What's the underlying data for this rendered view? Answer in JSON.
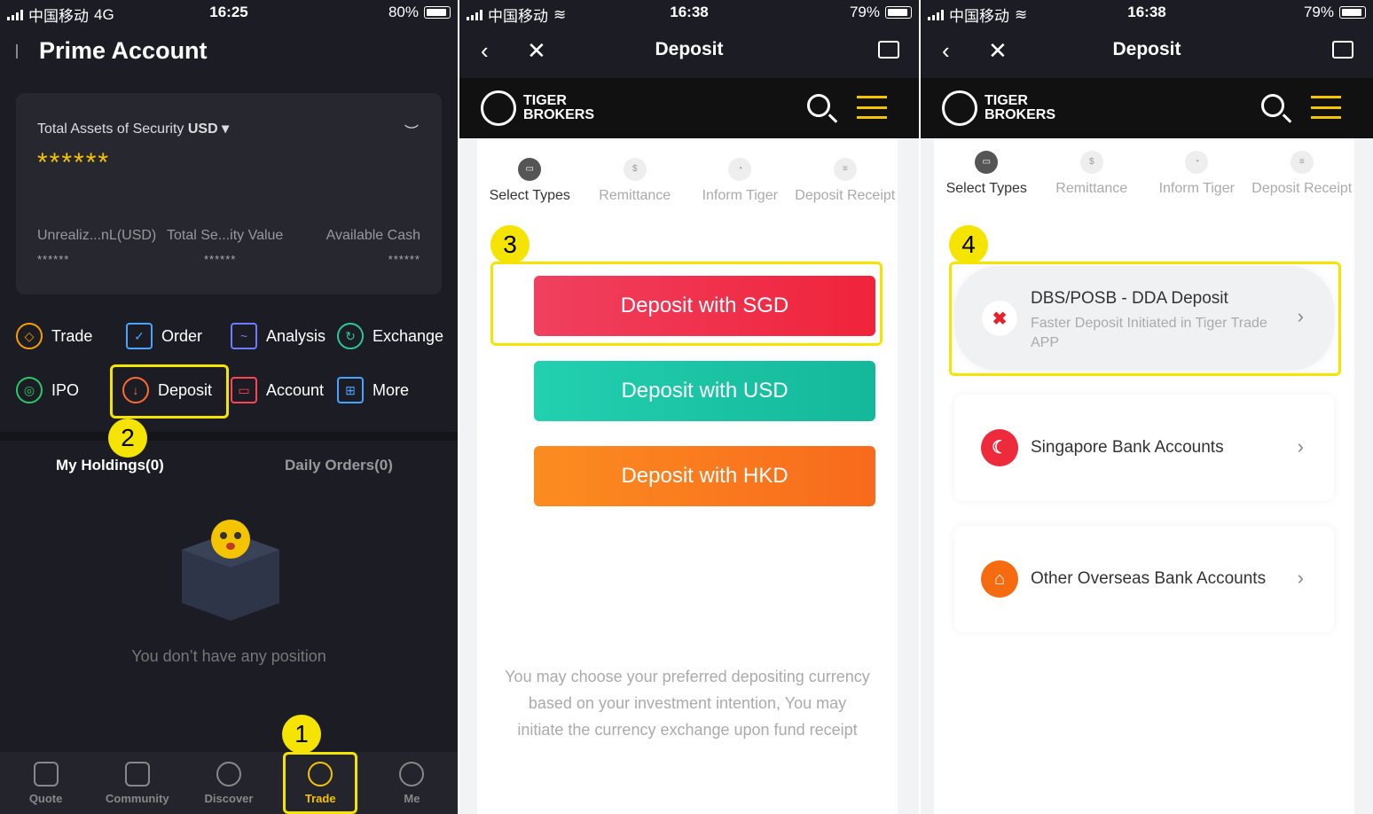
{
  "screen1": {
    "status": {
      "carrier": "中国移动",
      "network": "4G",
      "time": "16:25",
      "battery": "80%"
    },
    "title": "Prime Account",
    "card": {
      "label": "Total Assets of Security",
      "currency": "USD ▾",
      "stars": "******",
      "c1": "Unrealiz...nL(USD)",
      "c2": "Total Se...ity Value",
      "c3": "Available Cash",
      "v1": "******",
      "v2": "******",
      "v3": "******"
    },
    "links": [
      {
        "label": "Trade"
      },
      {
        "label": "Order"
      },
      {
        "label": "Analysis"
      },
      {
        "label": "Exchange"
      },
      {
        "label": "IPO"
      },
      {
        "label": "Deposit"
      },
      {
        "label": "Account"
      },
      {
        "label": "More"
      }
    ],
    "tabs": {
      "holdings": "My Holdings(0)",
      "orders": "Daily Orders(0)"
    },
    "empty": "You don’t have any position",
    "nav": [
      "Quote",
      "Community",
      "Discover",
      "Trade",
      "Me"
    ]
  },
  "screen2": {
    "status": {
      "carrier": "中国移动",
      "time": "16:38",
      "battery": "79%"
    },
    "title": "Deposit",
    "brand1": "TIGER",
    "brand2": "BROKERS",
    "steps": [
      {
        "label": "Select Types"
      },
      {
        "label": "Remittance"
      },
      {
        "label": "Inform Tiger"
      },
      {
        "label": "Deposit Receipt"
      }
    ],
    "buttons": [
      "Deposit with SGD",
      "Deposit with USD",
      "Deposit with HKD"
    ],
    "note": "You may choose your preferred depositing currency based on your investment intention, You may initiate the currency exchange upon fund receipt"
  },
  "screen3": {
    "status": {
      "carrier": "中国移动",
      "time": "16:38",
      "battery": "79%"
    },
    "title": "Deposit",
    "brand1": "TIGER",
    "brand2": "BROKERS",
    "steps": [
      {
        "label": "Select Types"
      },
      {
        "label": "Remittance"
      },
      {
        "label": "Inform Tiger"
      },
      {
        "label": "Deposit Receipt"
      }
    ],
    "options": [
      {
        "title": "DBS/POSB - DDA Deposit",
        "sub": "Faster Deposit Initiated in Tiger Trade APP"
      },
      {
        "title": "Singapore Bank Accounts"
      },
      {
        "title": "Other Overseas Bank Accounts"
      }
    ]
  },
  "markers": [
    "1",
    "2",
    "3",
    "4"
  ],
  "colors": {
    "highlight": "#f5e400",
    "accent": "#f5c400",
    "sgd": "#f0334a",
    "usd": "#1fc8a8",
    "hkd": "#fa7a1e"
  }
}
